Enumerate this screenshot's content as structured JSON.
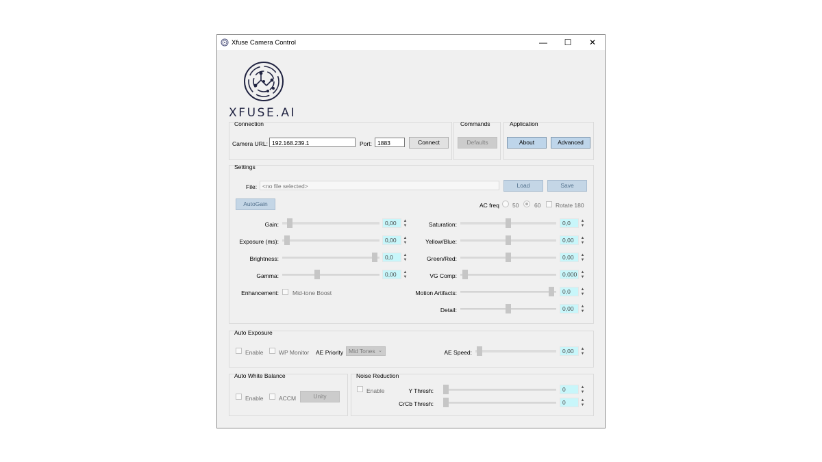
{
  "window": {
    "title": "Xfuse Camera Control",
    "controls": {
      "minimize": "—",
      "maximize": "☐",
      "close": "✕"
    }
  },
  "logo": {
    "text": "XFUSE.AI",
    "color": "#1f2240"
  },
  "connection": {
    "label": "Connection",
    "url_label": "Camera URL:",
    "url_value": "192.168.239.1",
    "port_label": "Port:",
    "port_value": "1883",
    "connect_label": "Connect"
  },
  "commands": {
    "label": "Commands",
    "defaults_label": "Defaults"
  },
  "application": {
    "label": "Application",
    "about_label": "About",
    "advanced_label": "Advanced"
  },
  "settings": {
    "label": "Settings",
    "file_label": "File:",
    "file_placeholder": "<no file selected>",
    "load_label": "Load",
    "save_label": "Save",
    "autogain_label": "AutoGain",
    "acfreq_label": "AC freq",
    "acfreq_options": [
      "50",
      "60"
    ],
    "acfreq_selected": "60",
    "rotate_label": "Rotate 180",
    "left_sliders": [
      {
        "label": "Gain:",
        "value": "0,00",
        "level": 0.05
      },
      {
        "label": "Exposure (ms):",
        "value": "0,00",
        "level": 0.02
      },
      {
        "label": "Brightness:",
        "value": "0,0",
        "level": 0.98
      },
      {
        "label": "Gamma:",
        "value": "0,00",
        "level": 0.35
      }
    ],
    "enhancement_label": "Enhancement:",
    "midtone_label": "Mid-tone Boost",
    "right_sliders": [
      {
        "label": "Saturation:",
        "value": "0,0",
        "level": 0.5
      },
      {
        "label": "Yellow/Blue:",
        "value": "0,00",
        "level": 0.5
      },
      {
        "label": "Green/Red:",
        "value": "0,00",
        "level": 0.5
      },
      {
        "label": "VG Comp:",
        "value": "0,000",
        "level": 0.02
      },
      {
        "label": "Motion Artifacts:",
        "value": "0,0",
        "level": 0.98
      },
      {
        "label": "Detail:",
        "value": "0,00",
        "level": 0.5
      }
    ]
  },
  "auto_exposure": {
    "label": "Auto Exposure",
    "enable_label": "Enable",
    "wp_monitor_label": "WP Monitor",
    "priority_label": "AE Priority",
    "priority_value": "Mid Tones",
    "speed_label": "AE Speed:",
    "speed_value": "0,00",
    "speed_level": 0.02
  },
  "awb": {
    "label": "Auto White Balance",
    "enable_label": "Enable",
    "accm_label": "ACCM",
    "unity_label": "Unity"
  },
  "noise": {
    "label": "Noise Reduction",
    "enable_label": "Enable",
    "y_label": "Y Thresh:",
    "y_value": "0",
    "y_level": 0.0,
    "c_label": "CrCb Thresh:",
    "c_value": "0",
    "c_level": 0.0
  }
}
